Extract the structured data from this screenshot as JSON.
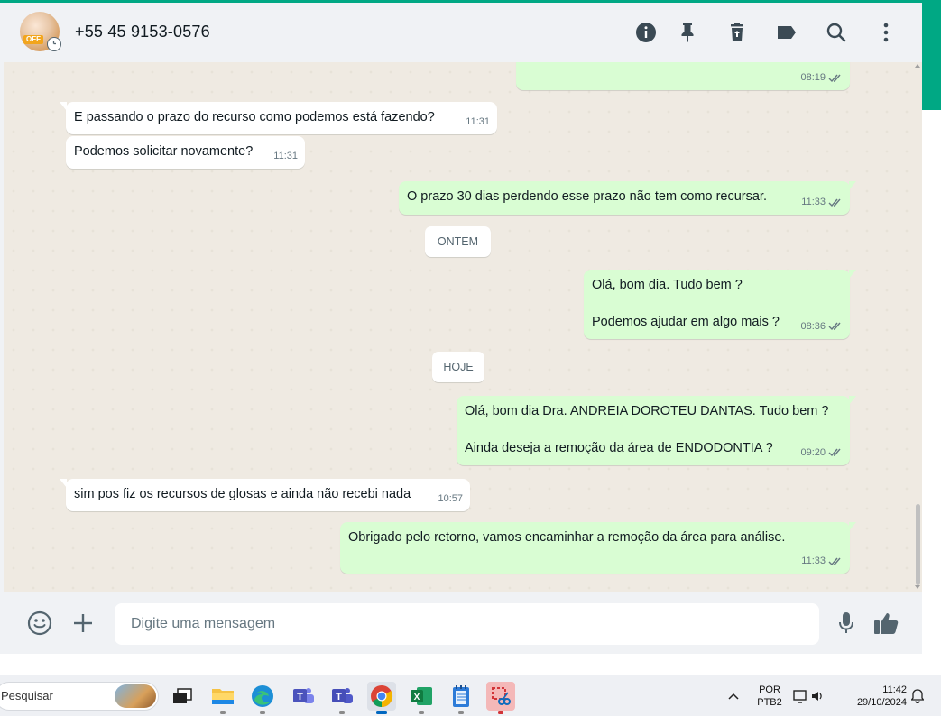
{
  "header": {
    "contact_name": "+55 45 9153-0576",
    "avatar_text": "OFF",
    "icons": [
      "info-icon",
      "pin-icon",
      "delete-icon",
      "label-icon",
      "search-icon",
      "menu-icon"
    ]
  },
  "chat": {
    "messages": [
      {
        "direction": "out",
        "text": "",
        "time": "08:19",
        "ticks": "read"
      },
      {
        "direction": "in",
        "text": "E passando o prazo do recurso como podemos está fazendo?",
        "time": "11:31"
      },
      {
        "direction": "in",
        "text": "Podemos solicitar novamente?",
        "time": "11:31"
      },
      {
        "direction": "out",
        "text": "O prazo 30 dias perdendo esse prazo não tem como recursar.",
        "time": "11:33",
        "ticks": "read"
      },
      {
        "direction": "out",
        "text": "Olá, bom dia. Tudo bem ?\n\nPodemos ajudar em algo mais ?",
        "time": "08:36",
        "ticks": "read"
      },
      {
        "direction": "out",
        "text": "Olá, bom dia Dra. ANDREIA DOROTEU DANTAS. Tudo bem ?\n\nAinda deseja a remoção da área de ENDODONTIA ?",
        "time": "09:20",
        "ticks": "read"
      },
      {
        "direction": "in",
        "text": "sim pos fiz os recursos de glosas e ainda não recebi nada",
        "time": "10:57"
      },
      {
        "direction": "out",
        "text": "Obrigado pelo retorno, vamos encaminhar a remoção da área para análise.",
        "time": "11:33",
        "ticks": "read"
      }
    ],
    "date_chips": [
      "ONTEM",
      "HOJE"
    ]
  },
  "composer": {
    "placeholder": "Digite uma mensagem",
    "icons": [
      "emoji-icon",
      "plus-icon",
      "mic-icon",
      "thumbs-up-icon"
    ]
  },
  "taskbar": {
    "search_placeholder": "Pesquisar",
    "apps": [
      "task-view",
      "file-explorer",
      "edge",
      "teams",
      "teams-classic",
      "chrome",
      "excel",
      "notepad",
      "snipping-tool"
    ],
    "active_app": "chrome",
    "lang_primary": "POR",
    "lang_secondary": "PTB2",
    "time": "11:42",
    "date": "29/10/2024"
  },
  "colors": {
    "accent_green": "#00a884",
    "outgoing_bubble": "#d9fdd3",
    "incoming_bubble": "#ffffff",
    "chat_background": "#efeae2",
    "read_ticks": "#667781"
  }
}
